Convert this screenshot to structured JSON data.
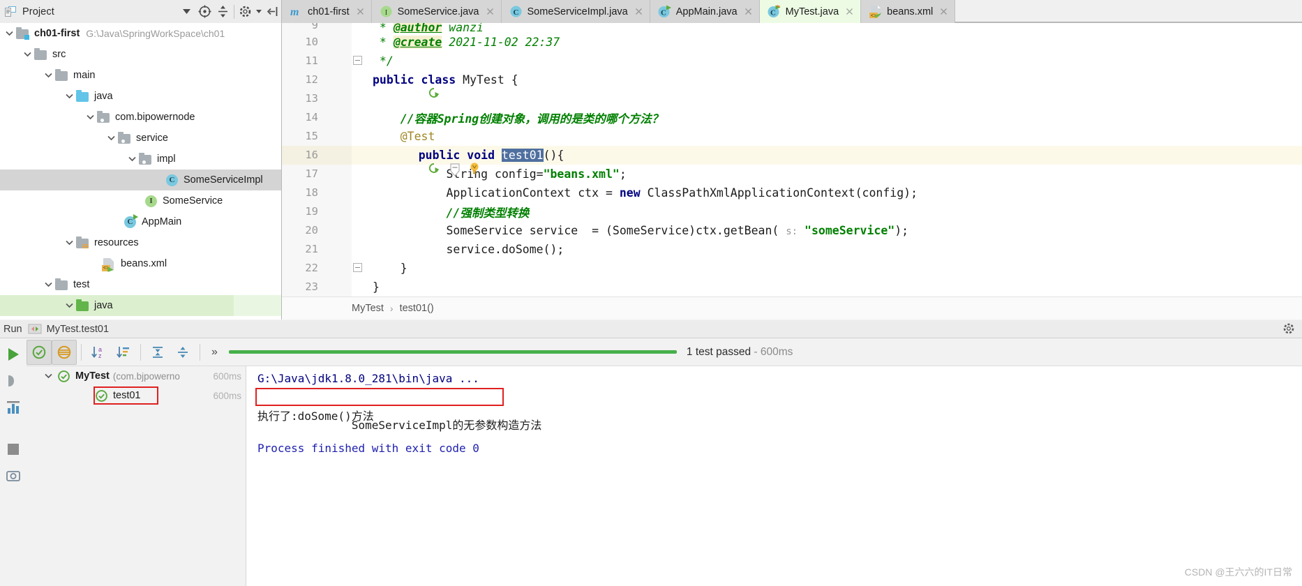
{
  "project_panel": {
    "title": "Project",
    "icons": [
      "project-view-icon",
      "locate-icon",
      "collapse-all-icon",
      "settings-icon",
      "hide-icon"
    ]
  },
  "tabs": [
    {
      "label": "ch01-first",
      "icon": "maven-module-icon",
      "active": false,
      "closable": true
    },
    {
      "label": "SomeService.java",
      "icon": "java-interface-icon",
      "active": false,
      "closable": true
    },
    {
      "label": "SomeServiceImpl.java",
      "icon": "java-class-icon",
      "active": false,
      "closable": true
    },
    {
      "label": "AppMain.java",
      "icon": "java-class-runnable-icon",
      "active": false,
      "closable": true
    },
    {
      "label": "MyTest.java",
      "icon": "java-class-test-icon",
      "active": true,
      "closable": true
    },
    {
      "label": "beans.xml",
      "icon": "spring-xml-icon",
      "active": false,
      "closable": true
    }
  ],
  "tree": [
    {
      "label": "ch01-first",
      "path": "G:\\Java\\SpringWorkSpace\\ch01",
      "indent": 0,
      "arrow": "down",
      "icon": "module-folder-icon",
      "bold": true,
      "state": "none"
    },
    {
      "label": "src",
      "path": "",
      "indent": 1,
      "arrow": "down",
      "icon": "folder-icon",
      "bold": false,
      "state": "none"
    },
    {
      "label": "main",
      "path": "",
      "indent": 2,
      "arrow": "down",
      "icon": "folder-icon",
      "bold": false,
      "state": "none"
    },
    {
      "label": "java",
      "path": "",
      "indent": 3,
      "arrow": "down",
      "icon": "source-folder-icon",
      "bold": false,
      "state": "none"
    },
    {
      "label": "com.bipowernode",
      "path": "",
      "indent": 4,
      "arrow": "down",
      "icon": "package-icon",
      "bold": false,
      "state": "none"
    },
    {
      "label": "service",
      "path": "",
      "indent": 5,
      "arrow": "down",
      "icon": "package-icon",
      "bold": false,
      "state": "none"
    },
    {
      "label": "impl",
      "path": "",
      "indent": 6,
      "arrow": "down",
      "icon": "package-icon",
      "bold": false,
      "state": "none"
    },
    {
      "label": "SomeServiceImpl",
      "path": "",
      "indent": 7,
      "arrow": "none",
      "icon": "java-class-icon",
      "bold": false,
      "state": "selected"
    },
    {
      "label": "SomeService",
      "path": "",
      "indent": 6,
      "arrow": "none",
      "icon": "java-interface-icon",
      "bold": false,
      "state": "none"
    },
    {
      "label": "AppMain",
      "path": "",
      "indent": 5,
      "arrow": "none",
      "icon": "java-class-runnable-icon",
      "bold": false,
      "state": "none"
    },
    {
      "label": "resources",
      "path": "",
      "indent": 3,
      "arrow": "down",
      "icon": "resources-folder-icon",
      "bold": false,
      "state": "none"
    },
    {
      "label": "beans.xml",
      "path": "",
      "indent": 4,
      "arrow": "none",
      "icon": "spring-xml-icon",
      "bold": false,
      "state": "none"
    },
    {
      "label": "test",
      "path": "",
      "indent": 2,
      "arrow": "down",
      "icon": "folder-icon",
      "bold": false,
      "state": "none"
    },
    {
      "label": "java",
      "path": "",
      "indent": 3,
      "arrow": "down",
      "icon": "test-source-folder-icon",
      "bold": false,
      "state": "highlight"
    }
  ],
  "code": {
    "lines": [
      {
        "num": "9",
        "text_html": "<span class=\"tag\">@author</span> <span class=\"doc\">wanzi</span>",
        "prefix_html": " * ",
        "marks": [],
        "current": false,
        "clipped": true
      },
      {
        "num": "10",
        "text_html": "<span class=\"tag\">@create</span> <span class=\"doc\">2021-11-02 22:37</span>",
        "prefix_html": " * ",
        "marks": [],
        "current": false,
        "clipped": false
      },
      {
        "num": "11",
        "text_html": "<span class=\"doc\">*/</span>",
        "prefix_html": " ",
        "marks": [
          "fold-minus"
        ],
        "current": false,
        "clipped": false
      },
      {
        "num": "12",
        "text_html": "<span class=\"kw\">public class</span> <span class=\"plain\">MyTest {</span>",
        "prefix_html": "",
        "marks": [
          "run-class"
        ],
        "current": false,
        "clipped": false
      },
      {
        "num": "13",
        "text_html": "",
        "prefix_html": "",
        "marks": [],
        "current": false,
        "clipped": false
      },
      {
        "num": "14",
        "text_html": "<span class=\"cmt\">    //容器Spring创建对象，调用的是类的哪个方法？</span>",
        "prefix_html": "",
        "marks": [],
        "current": false,
        "clipped": false
      },
      {
        "num": "15",
        "text_html": "<span class=\"ann\">    @Test</span>",
        "prefix_html": "",
        "marks": [],
        "current": false,
        "clipped": false
      },
      {
        "num": "16",
        "text_html": "    <span class=\"kw\">public void</span> <span class=\"selx\">test01</span><span class=\"plain\">(){</span>",
        "prefix_html": "",
        "marks": [
          "run-method",
          "fold-arrow",
          "bulb"
        ],
        "current": true,
        "clipped": false
      },
      {
        "num": "17",
        "text_html": "        <span class=\"plain\">String config=</span><span class=\"str\">\"beans.xml\"</span><span class=\"plain\">;</span>",
        "prefix_html": "",
        "marks": [],
        "current": false,
        "clipped": false
      },
      {
        "num": "18",
        "text_html": "        <span class=\"plain\">ApplicationContext ctx = </span><span class=\"kw\">new</span> <span class=\"plain\">ClassPathXmlApplicationContext(config);</span>",
        "prefix_html": "",
        "marks": [],
        "current": false,
        "clipped": false
      },
      {
        "num": "19",
        "text_html": "        <span class=\"cmt\">//强制类型转换</span>",
        "prefix_html": "",
        "marks": [],
        "current": false,
        "clipped": false
      },
      {
        "num": "20",
        "text_html": "        <span class=\"plain\">SomeService service  = (SomeService)ctx.getBean( </span><span class=\"hint\">s:</span> <span class=\"str\">\"someService\"</span><span class=\"plain\">);</span>",
        "prefix_html": "",
        "marks": [],
        "current": false,
        "clipped": false
      },
      {
        "num": "21",
        "text_html": "        <span class=\"plain\">service.doSome();</span>",
        "prefix_html": "",
        "marks": [],
        "current": false,
        "clipped": false
      },
      {
        "num": "22",
        "text_html": "    <span class=\"plain\">}</span>",
        "prefix_html": "",
        "marks": [
          "fold-minus"
        ],
        "current": false,
        "clipped": false
      },
      {
        "num": "23",
        "text_html": "<span class=\"plain\">}</span>",
        "prefix_html": "",
        "marks": [],
        "current": false,
        "clipped": false
      }
    ],
    "breadcrumb": [
      "MyTest",
      "test01()"
    ]
  },
  "run_panel": {
    "title": "Run",
    "config_name": "MyTest.test01",
    "toolbar": {
      "rerun": "rerun-icon",
      "show_passed": "show-passed-icon",
      "show_ignored": "show-ignored-icon",
      "sort_alpha": "sort-alphabetically-icon",
      "sort_duration": "sort-by-duration-icon",
      "expand_all": "expand-all-icon",
      "collapse_all": "collapse-all-icon",
      "more": "»"
    },
    "status": {
      "passed_label": "1 test passed",
      "separator": "-",
      "duration": "600ms"
    },
    "test_tree": [
      {
        "label": "MyTest",
        "sub": "(com.bjpowerno",
        "time": "600ms",
        "arrow": "down",
        "icon": "test-passed-icon",
        "boxed": false
      },
      {
        "label": "test01",
        "sub": "",
        "time": "600ms",
        "arrow": "none",
        "icon": "test-passed-icon",
        "boxed": true
      }
    ],
    "console": [
      {
        "text": "G:\\Java\\jdk1.8.0_281\\bin\\java ...",
        "style": "link",
        "boxed": false
      },
      {
        "text": "SomeServiceImpl的无参数构造方法",
        "style": "plain",
        "boxed": true
      },
      {
        "text": "执行了:doSome()方法",
        "style": "plain",
        "boxed": false
      },
      {
        "text": "",
        "style": "plain",
        "boxed": false
      },
      {
        "text": "Process finished with exit code 0",
        "style": "blue",
        "boxed": false
      }
    ],
    "rail_icons": [
      "run-tool-icon",
      "debug-tool-icon",
      "profiler-tool-icon",
      "stop-icon",
      "screenshot-icon"
    ],
    "watermark": "CSDN @王六六的IT日常"
  },
  "colors": {
    "accent_green": "#46b04a",
    "tab_active_bg": "#edfbe4",
    "selection_blue": "#4f6f9f",
    "red_box": "#e02020",
    "keyword": "#000080",
    "string": "#008000",
    "comment": "#008000"
  }
}
